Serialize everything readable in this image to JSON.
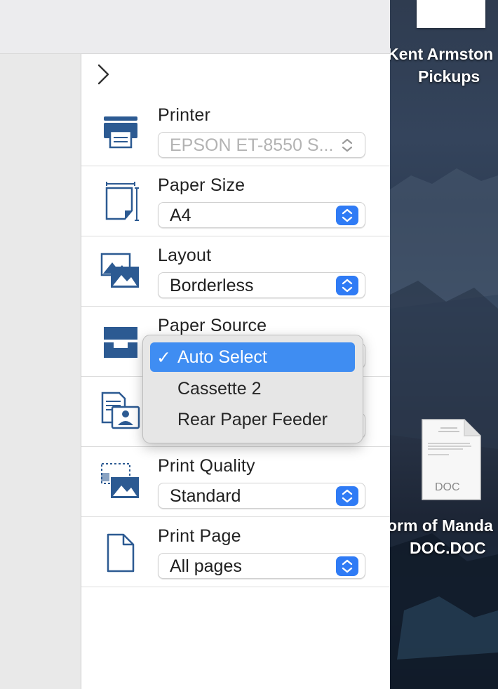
{
  "sidebar_toggle": {
    "icon": "chevron-right-icon"
  },
  "settings": [
    {
      "label": "Printer",
      "value": "EPSON ET-8550 S...",
      "icon": "printer-icon",
      "disabled": true
    },
    {
      "label": "Paper Size",
      "value": "A4",
      "icon": "paper-size-icon"
    },
    {
      "label": "Layout",
      "value": "Borderless",
      "icon": "layout-icon"
    },
    {
      "label": "Paper Source",
      "value": "",
      "icon": "paper-source-icon"
    },
    {
      "label": "",
      "value": "",
      "icon": "document-type-icon"
    },
    {
      "label": "Print Quality",
      "value": "Standard",
      "icon": "print-quality-icon"
    },
    {
      "label": "Print Page",
      "value": "All pages",
      "icon": "print-page-icon"
    }
  ],
  "paper_source_menu": {
    "items": [
      "Auto Select",
      "Cassette 2",
      "Rear Paper Feeder"
    ],
    "selected": "Auto Select",
    "check_mark": "✓"
  },
  "desktop": {
    "file1_label_line1": "Kent Armston",
    "file1_label_line2": "Pickups",
    "file2_badge": "DOC",
    "file2_label_line1": "orm of Manda",
    "file2_label_line2": "DOC.DOC"
  },
  "colors": {
    "accent": "#2f7bf5",
    "menu_highlight": "#3f8df2",
    "icon_blue": "#2c5a92"
  }
}
